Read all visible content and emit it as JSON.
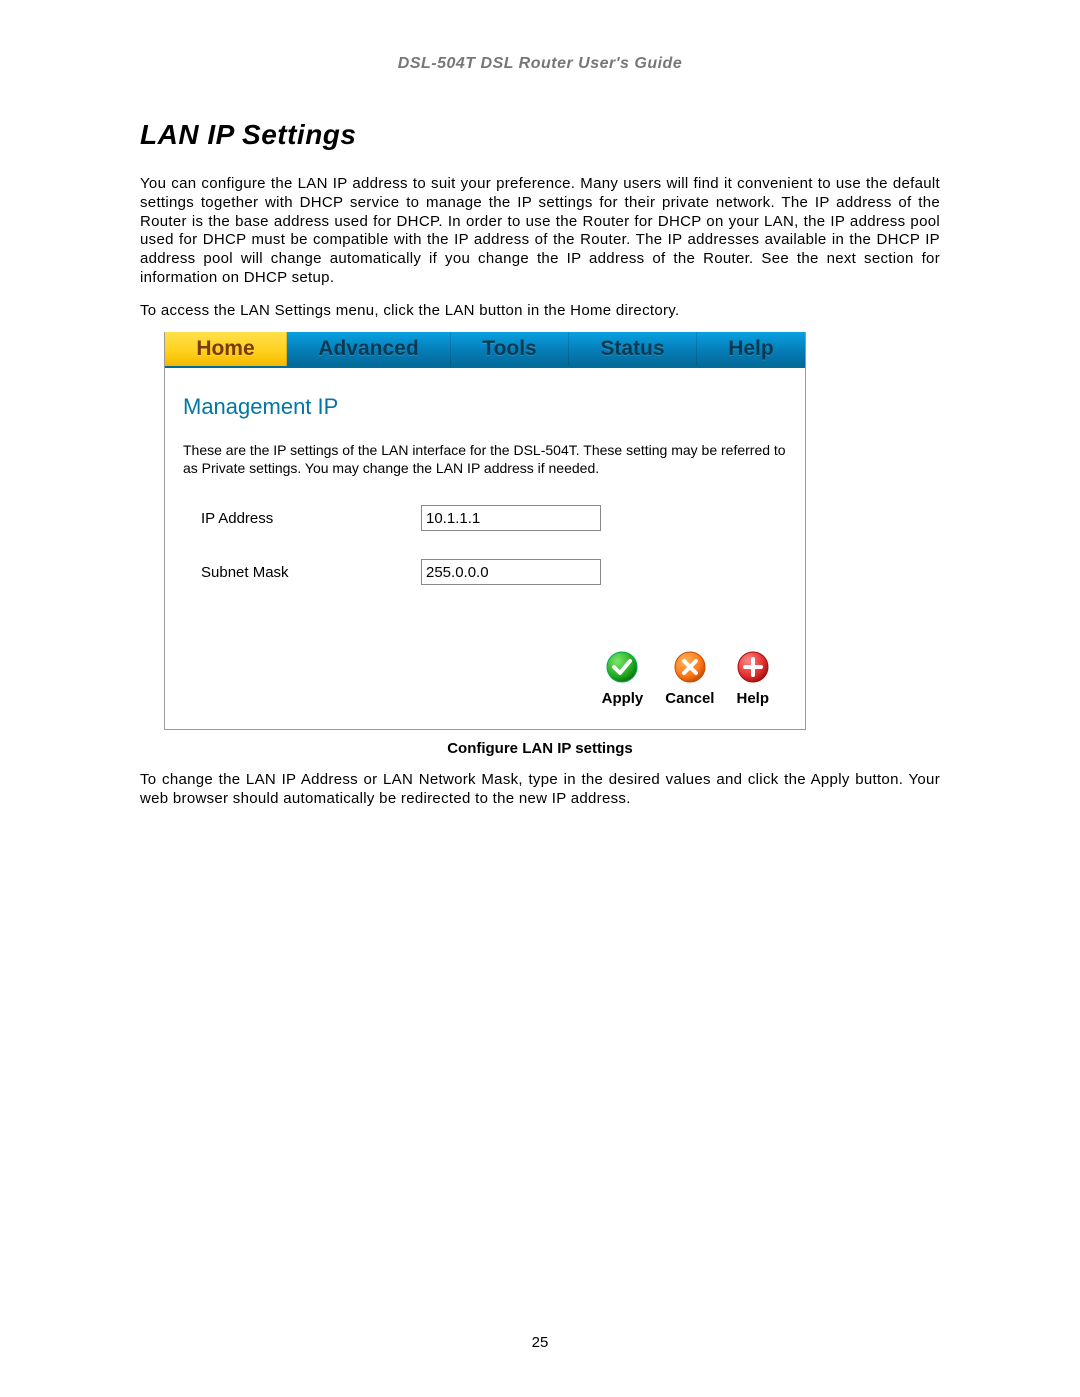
{
  "doc_header": "DSL-504T DSL Router User's Guide",
  "section_title": "LAN IP Settings",
  "paragraph_1": "You can configure the LAN IP address to suit your preference. Many users will find it convenient to use the default settings together with DHCP service to manage the IP settings for their private network. The IP address of the Router is the base address used for DHCP. In order to use the Router for DHCP on your LAN, the IP address pool used for DHCP must be compatible with the IP address of the Router. The IP addresses available in the DHCP IP address pool will change automatically if you change the IP address of the Router. See the next section for information on DHCP setup.",
  "paragraph_2": "To access the LAN Settings menu, click the LAN button in the Home directory.",
  "tabs": {
    "home": "Home",
    "advanced": "Advanced",
    "tools": "Tools",
    "status": "Status",
    "help": "Help"
  },
  "panel": {
    "heading": "Management IP",
    "description": "These are the IP settings of the LAN interface for the DSL-504T. These setting may be referred to as Private settings. You may change the LAN IP address if needed.",
    "ip_label": "IP Address",
    "ip_value": "10.1.1.1",
    "subnet_label": "Subnet Mask",
    "subnet_value": "255.0.0.0"
  },
  "buttons": {
    "apply": "Apply",
    "cancel": "Cancel",
    "help": "Help"
  },
  "figure_caption": "Configure LAN IP settings",
  "paragraph_3": "To change the LAN IP Address or LAN Network Mask, type in the desired values and click the Apply button.  Your web browser should automatically be redirected to the new IP address.",
  "page_number": "25"
}
